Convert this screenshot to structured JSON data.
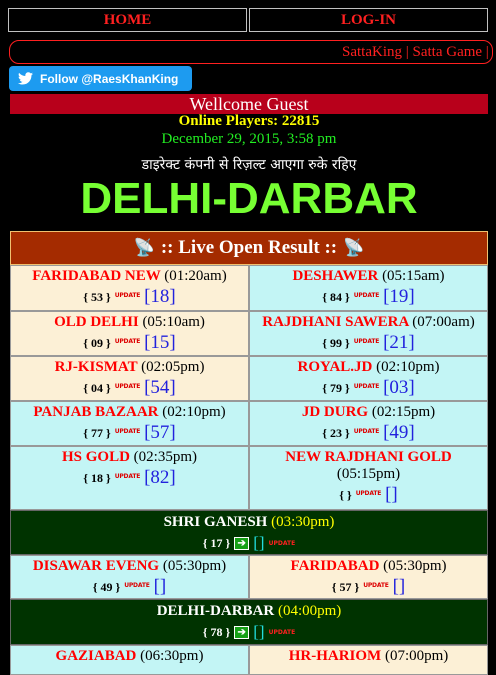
{
  "nav": {
    "home": "HOME",
    "login": "LOG-IN"
  },
  "marquee": "SattaKing | Satta Game | Satta Result | Gali Result",
  "twitter": {
    "label": "Follow @RaesKhanKing",
    "color": "#1d9bf0"
  },
  "welcome": "Wellcome Guest",
  "online_players": "Online Players: 22815",
  "date": "December 29, 2015, 3:58 pm",
  "notice": "डाइरेक्ट कंपनी से रिज़ल्ट आएगा रुके रहिए",
  "brand": "DELHI-DARBAR",
  "live_header": ":: Live Open Result ::",
  "update_badge": "UPDATE",
  "pairs": [
    [
      {
        "name": "FARIDABAD NEW",
        "time": "(01:20am)",
        "open": "{ 53 }",
        "result": "[18]"
      },
      {
        "name": "DESHAWER",
        "time": "(05:15am)",
        "open": "{ 84 }",
        "result": "[19]"
      }
    ],
    [
      {
        "name": "OLD DELHI",
        "time": "(05:10am)",
        "open": "{ 09 }",
        "result": "[15]"
      },
      {
        "name": "RAJDHANI SAWERA",
        "time": "(07:00am)",
        "open": "{ 99 }",
        "result": "[21]"
      }
    ],
    [
      {
        "name": "RJ-KISMAT",
        "time": "(02:05pm)",
        "open": "{ 04 }",
        "result": "[54]"
      },
      {
        "name": "ROYAL.JD",
        "time": "(02:10pm)",
        "open": "{ 79 }",
        "result": "[03]"
      }
    ],
    [
      {
        "name": "PANJAB BAZAAR",
        "time": "(02:10pm)",
        "open": "{ 77 }",
        "result": "[57]"
      },
      {
        "name": "JD DURG",
        "time": "(02:15pm)",
        "open": "{ 23 }",
        "result": "[49]"
      }
    ],
    [
      {
        "name": "HS GOLD",
        "time": "(02:35pm)",
        "open": "{ 18 }",
        "result": "[82]"
      },
      {
        "name": "NEW RAJDHANI GOLD",
        "time": "(05:15pm)",
        "open": "{ }",
        "result": "[]"
      }
    ]
  ],
  "featured1": {
    "name": "SHRI GANESH",
    "time": "(03:30pm)",
    "open": "{ 17 }",
    "result": "[]",
    "badge": "UPDATE"
  },
  "pair6": [
    {
      "name": "DISAWAR EVENG",
      "time": "(05:30pm)",
      "open": "{ 49 }",
      "result": "[]"
    },
    {
      "name": "FARIDABAD",
      "time": "(05:30pm)",
      "open": "{ 57 }",
      "result": "[]"
    }
  ],
  "featured2": {
    "name": "DELHI-DARBAR",
    "time": "(04:00pm)",
    "open": "{ 78 }",
    "result": "[]",
    "badge": "UPDATE"
  },
  "pair7": [
    {
      "name": "GAZIABAD",
      "time": "(06:30pm)"
    },
    {
      "name": "HR-HARIOM",
      "time": "(07:00pm)"
    }
  ],
  "colors": {
    "accent_red": "#ff0000",
    "brand_green": "#77ff33",
    "welcome_bar": "#b8001b",
    "live_bar": "#a42b00"
  }
}
